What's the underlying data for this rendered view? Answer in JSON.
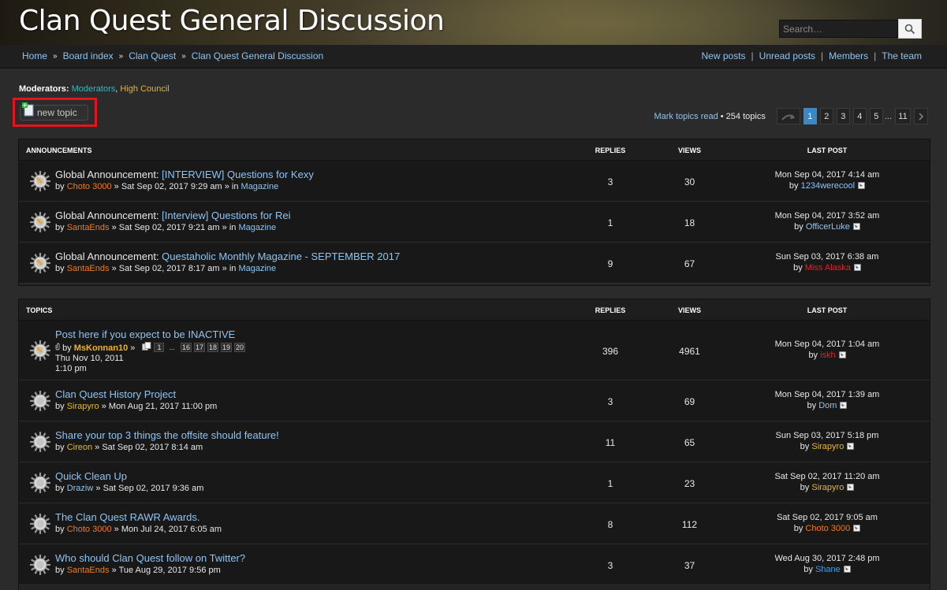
{
  "header": {
    "title": "Clan Quest General Discussion",
    "search_placeholder": "Search…"
  },
  "breadcrumb": [
    "Home",
    "Board index",
    "Clan Quest",
    "Clan Quest General Discussion"
  ],
  "navlinks": [
    "New posts",
    "Unread posts",
    "Members",
    "The team"
  ],
  "moderators": {
    "label": "Moderators:",
    "groups": [
      {
        "name": "Moderators",
        "color": "#2fb8b8"
      },
      {
        "name": "High Council",
        "color": "#e8b22a"
      }
    ]
  },
  "actions": {
    "new_topic": "new topic",
    "mark_read": "Mark topics read",
    "topic_count": "254 topics"
  },
  "pagination": {
    "pages": [
      "1",
      "2",
      "3",
      "4",
      "5"
    ],
    "ellipsis": "...",
    "last": "11",
    "current": "1"
  },
  "announcements": {
    "header": {
      "title": "Announcements",
      "replies": "Replies",
      "views": "Views",
      "last_post": "Last post"
    },
    "rows": [
      {
        "prefix": "Global Announcement:",
        "title": "[INTERVIEW] Questions for Kexy",
        "author": "Choto 3000",
        "author_color": "#f07b1e",
        "date": "Sat Sep 02, 2017 9:29 am",
        "forum": "Magazine",
        "replies": "3",
        "views": "30",
        "last_date": "Mon Sep 04, 2017 4:14 am",
        "last_user": "1234werecool",
        "last_user_color": "#8ec4f2"
      },
      {
        "prefix": "Global Announcement:",
        "title": "[Interview] Questions for Rei",
        "author": "SantaEnds",
        "author_color": "#f07b1e",
        "date": "Sat Sep 02, 2017 9:21 am",
        "forum": "Magazine",
        "replies": "1",
        "views": "18",
        "last_date": "Mon Sep 04, 2017 3:52 am",
        "last_user": "OfficerLuke",
        "last_user_color": "#8ec4f2"
      },
      {
        "prefix": "Global Announcement:",
        "title": "Questaholic Monthly Magazine - SEPTEMBER 2017",
        "author": "SantaEnds",
        "author_color": "#f07b1e",
        "date": "Sat Sep 02, 2017 8:17 am",
        "forum": "Magazine",
        "replies": "9",
        "views": "67",
        "last_date": "Sun Sep 03, 2017 6:38 am",
        "last_user": "Miss Alaska",
        "last_user_color": "#d8242a"
      }
    ]
  },
  "topics": {
    "header": {
      "title": "Topics",
      "replies": "Replies",
      "views": "Views",
      "last_post": "Last post"
    },
    "sticky": {
      "title": "Post here if you expect to be INACTIVE",
      "author": "MsKonnan10",
      "author_color": "#eeb51d",
      "pages": [
        "1",
        "16",
        "17",
        "18",
        "19",
        "20"
      ],
      "page_ellipsis": "...",
      "date_line1": "Thu Nov 10, 2011",
      "date_line2": "1:10 pm",
      "replies": "396",
      "views": "4961",
      "last_date": "Mon Sep 04, 2017 1:04 am",
      "last_user": "iskh",
      "last_user_color": "#d8242a"
    },
    "rows": [
      {
        "title": "Clan Quest History Project",
        "author": "Sirapyro",
        "author_color": "#eeb51d",
        "date": "Mon Aug 21, 2017 11:00 pm",
        "replies": "3",
        "views": "69",
        "last_date": "Mon Sep 04, 2017 1:39 am",
        "last_user": "Dom",
        "last_user_color": "#8ec4f2"
      },
      {
        "title": "Share your top 3 things the offsite should feature!",
        "author": "Cireon",
        "author_color": "#eeb51d",
        "date": "Sat Sep 02, 2017 8:14 am",
        "replies": "11",
        "views": "65",
        "last_date": "Sun Sep 03, 2017 5:18 pm",
        "last_user": "Sirapyro",
        "last_user_color": "#eeb51d"
      },
      {
        "title": "Quick Clean Up",
        "author": "Draziw",
        "author_color": "#8ec4f2",
        "date": "Sat Sep 02, 2017 9:36 am",
        "replies": "1",
        "views": "23",
        "last_date": "Sat Sep 02, 2017 11:20 am",
        "last_user": "Sirapyro",
        "last_user_color": "#eeb51d"
      },
      {
        "title": "The Clan Quest RAWR Awards.",
        "author": "Choto 3000",
        "author_color": "#f07b1e",
        "date": "Mon Jul 24, 2017 6:05 am",
        "replies": "8",
        "views": "112",
        "last_date": "Sat Sep 02, 2017 9:05 am",
        "last_user": "Choto 3000",
        "last_user_color": "#f07b1e"
      },
      {
        "title": "Who should Clan Quest follow on Twitter?",
        "author": "SantaEnds",
        "author_color": "#f07b1e",
        "date": "Tue Aug 29, 2017 9:56 pm",
        "replies": "3",
        "views": "37",
        "last_date": "Wed Aug 30, 2017 2:48 pm",
        "last_user": "Shane",
        "last_user_color": "#3a9cf0"
      }
    ]
  },
  "text": {
    "by": "by",
    "in": "in",
    "sep": "»"
  }
}
